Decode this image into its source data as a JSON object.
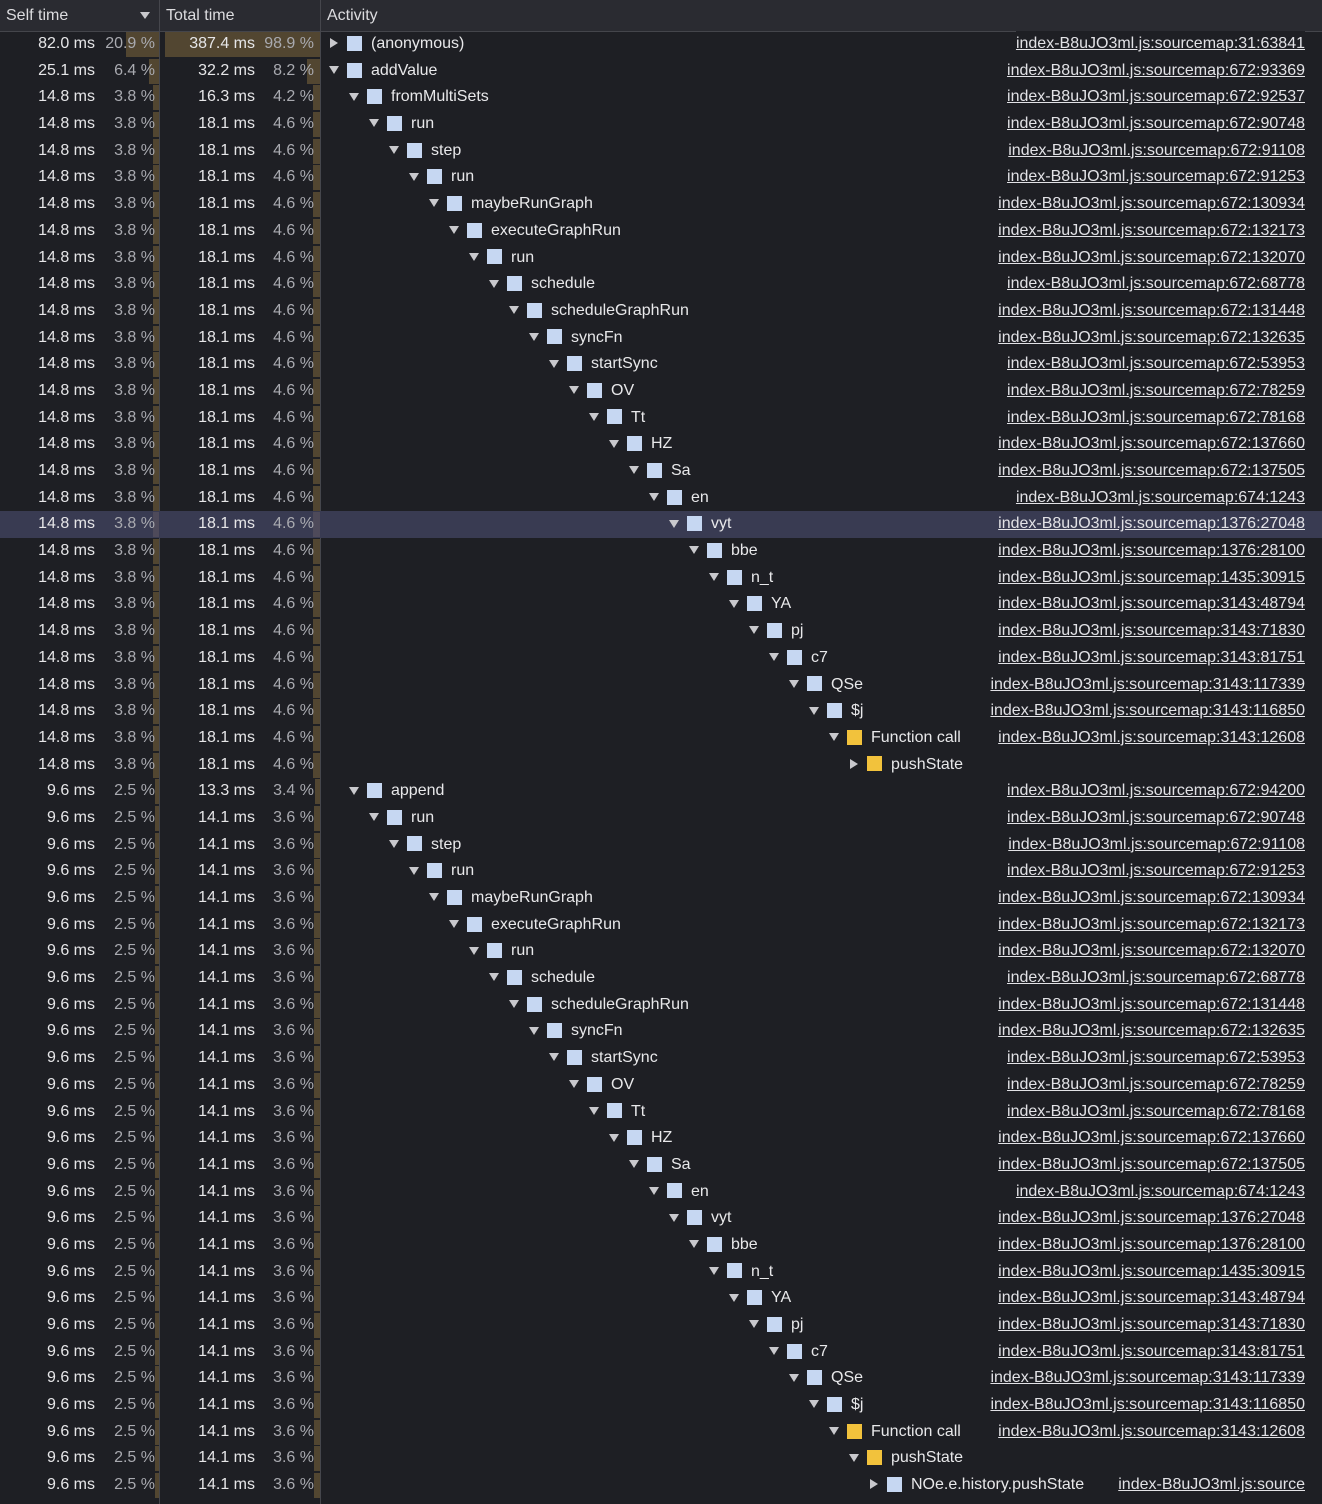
{
  "header": {
    "self_time": "Self time",
    "total_time": "Total time",
    "activity": "Activity"
  },
  "colors": {
    "background": "#1e1f24",
    "bar": "#524631",
    "selected_row": "#393b52",
    "node_icon": "#c6d7f2",
    "function_call_icon": "#f2c23c"
  },
  "rows": [
    {
      "self": "82.0 ms",
      "self_pct": "20.9 %",
      "self_frac": 0.209,
      "total": "387.4 ms",
      "total_pct": "98.9 %",
      "total_frac": 0.989,
      "depth": 0,
      "toggle": "collapsed",
      "icon": "blue",
      "name": "(anonymous)",
      "link": "index-B8uJO3ml.js:sourcemap:31:63841"
    },
    {
      "self": "25.1 ms",
      "self_pct": "6.4 %",
      "self_frac": 0.064,
      "total": "32.2 ms",
      "total_pct": "8.2 %",
      "total_frac": 0.082,
      "depth": 0,
      "toggle": "expanded",
      "icon": "blue",
      "name": "addValue",
      "link": "index-B8uJO3ml.js:sourcemap:672:93369"
    },
    {
      "self": "14.8 ms",
      "self_pct": "3.8 %",
      "self_frac": 0.038,
      "total": "16.3 ms",
      "total_pct": "4.2 %",
      "total_frac": 0.042,
      "depth": 1,
      "toggle": "expanded",
      "icon": "blue",
      "name": "fromMultiSets",
      "link": "index-B8uJO3ml.js:sourcemap:672:92537"
    },
    {
      "self": "14.8 ms",
      "self_pct": "3.8 %",
      "self_frac": 0.038,
      "total": "18.1 ms",
      "total_pct": "4.6 %",
      "total_frac": 0.046,
      "depth": 2,
      "toggle": "expanded",
      "icon": "blue",
      "name": "run",
      "link": "index-B8uJO3ml.js:sourcemap:672:90748"
    },
    {
      "self": "14.8 ms",
      "self_pct": "3.8 %",
      "self_frac": 0.038,
      "total": "18.1 ms",
      "total_pct": "4.6 %",
      "total_frac": 0.046,
      "depth": 3,
      "toggle": "expanded",
      "icon": "blue",
      "name": "step",
      "link": "index-B8uJO3ml.js:sourcemap:672:91108"
    },
    {
      "self": "14.8 ms",
      "self_pct": "3.8 %",
      "self_frac": 0.038,
      "total": "18.1 ms",
      "total_pct": "4.6 %",
      "total_frac": 0.046,
      "depth": 4,
      "toggle": "expanded",
      "icon": "blue",
      "name": "run",
      "link": "index-B8uJO3ml.js:sourcemap:672:91253"
    },
    {
      "self": "14.8 ms",
      "self_pct": "3.8 %",
      "self_frac": 0.038,
      "total": "18.1 ms",
      "total_pct": "4.6 %",
      "total_frac": 0.046,
      "depth": 5,
      "toggle": "expanded",
      "icon": "blue",
      "name": "maybeRunGraph",
      "link": "index-B8uJO3ml.js:sourcemap:672:130934"
    },
    {
      "self": "14.8 ms",
      "self_pct": "3.8 %",
      "self_frac": 0.038,
      "total": "18.1 ms",
      "total_pct": "4.6 %",
      "total_frac": 0.046,
      "depth": 6,
      "toggle": "expanded",
      "icon": "blue",
      "name": "executeGraphRun",
      "link": "index-B8uJO3ml.js:sourcemap:672:132173"
    },
    {
      "self": "14.8 ms",
      "self_pct": "3.8 %",
      "self_frac": 0.038,
      "total": "18.1 ms",
      "total_pct": "4.6 %",
      "total_frac": 0.046,
      "depth": 7,
      "toggle": "expanded",
      "icon": "blue",
      "name": "run",
      "link": "index-B8uJO3ml.js:sourcemap:672:132070"
    },
    {
      "self": "14.8 ms",
      "self_pct": "3.8 %",
      "self_frac": 0.038,
      "total": "18.1 ms",
      "total_pct": "4.6 %",
      "total_frac": 0.046,
      "depth": 8,
      "toggle": "expanded",
      "icon": "blue",
      "name": "schedule",
      "link": "index-B8uJO3ml.js:sourcemap:672:68778"
    },
    {
      "self": "14.8 ms",
      "self_pct": "3.8 %",
      "self_frac": 0.038,
      "total": "18.1 ms",
      "total_pct": "4.6 %",
      "total_frac": 0.046,
      "depth": 9,
      "toggle": "expanded",
      "icon": "blue",
      "name": "scheduleGraphRun",
      "link": "index-B8uJO3ml.js:sourcemap:672:131448"
    },
    {
      "self": "14.8 ms",
      "self_pct": "3.8 %",
      "self_frac": 0.038,
      "total": "18.1 ms",
      "total_pct": "4.6 %",
      "total_frac": 0.046,
      "depth": 10,
      "toggle": "expanded",
      "icon": "blue",
      "name": "syncFn",
      "link": "index-B8uJO3ml.js:sourcemap:672:132635"
    },
    {
      "self": "14.8 ms",
      "self_pct": "3.8 %",
      "self_frac": 0.038,
      "total": "18.1 ms",
      "total_pct": "4.6 %",
      "total_frac": 0.046,
      "depth": 11,
      "toggle": "expanded",
      "icon": "blue",
      "name": "startSync",
      "link": "index-B8uJO3ml.js:sourcemap:672:53953"
    },
    {
      "self": "14.8 ms",
      "self_pct": "3.8 %",
      "self_frac": 0.038,
      "total": "18.1 ms",
      "total_pct": "4.6 %",
      "total_frac": 0.046,
      "depth": 12,
      "toggle": "expanded",
      "icon": "blue",
      "name": "OV",
      "link": "index-B8uJO3ml.js:sourcemap:672:78259"
    },
    {
      "self": "14.8 ms",
      "self_pct": "3.8 %",
      "self_frac": 0.038,
      "total": "18.1 ms",
      "total_pct": "4.6 %",
      "total_frac": 0.046,
      "depth": 13,
      "toggle": "expanded",
      "icon": "blue",
      "name": "Tt",
      "link": "index-B8uJO3ml.js:sourcemap:672:78168"
    },
    {
      "self": "14.8 ms",
      "self_pct": "3.8 %",
      "self_frac": 0.038,
      "total": "18.1 ms",
      "total_pct": "4.6 %",
      "total_frac": 0.046,
      "depth": 14,
      "toggle": "expanded",
      "icon": "blue",
      "name": "HZ",
      "link": "index-B8uJO3ml.js:sourcemap:672:137660"
    },
    {
      "self": "14.8 ms",
      "self_pct": "3.8 %",
      "self_frac": 0.038,
      "total": "18.1 ms",
      "total_pct": "4.6 %",
      "total_frac": 0.046,
      "depth": 15,
      "toggle": "expanded",
      "icon": "blue",
      "name": "Sa",
      "link": "index-B8uJO3ml.js:sourcemap:672:137505"
    },
    {
      "self": "14.8 ms",
      "self_pct": "3.8 %",
      "self_frac": 0.038,
      "total": "18.1 ms",
      "total_pct": "4.6 %",
      "total_frac": 0.046,
      "depth": 16,
      "toggle": "expanded",
      "icon": "blue",
      "name": "en",
      "link": "index-B8uJO3ml.js:sourcemap:674:1243"
    },
    {
      "self": "14.8 ms",
      "self_pct": "3.8 %",
      "self_frac": 0.038,
      "total": "18.1 ms",
      "total_pct": "4.6 %",
      "total_frac": 0.046,
      "depth": 17,
      "toggle": "expanded",
      "icon": "blue",
      "name": "vyt",
      "link": "index-B8uJO3ml.js:sourcemap:1376:27048",
      "selected": true
    },
    {
      "self": "14.8 ms",
      "self_pct": "3.8 %",
      "self_frac": 0.038,
      "total": "18.1 ms",
      "total_pct": "4.6 %",
      "total_frac": 0.046,
      "depth": 18,
      "toggle": "expanded",
      "icon": "blue",
      "name": "bbe",
      "link": "index-B8uJO3ml.js:sourcemap:1376:28100"
    },
    {
      "self": "14.8 ms",
      "self_pct": "3.8 %",
      "self_frac": 0.038,
      "total": "18.1 ms",
      "total_pct": "4.6 %",
      "total_frac": 0.046,
      "depth": 19,
      "toggle": "expanded",
      "icon": "blue",
      "name": "n_t",
      "link": "index-B8uJO3ml.js:sourcemap:1435:30915"
    },
    {
      "self": "14.8 ms",
      "self_pct": "3.8 %",
      "self_frac": 0.038,
      "total": "18.1 ms",
      "total_pct": "4.6 %",
      "total_frac": 0.046,
      "depth": 20,
      "toggle": "expanded",
      "icon": "blue",
      "name": "YA",
      "link": "index-B8uJO3ml.js:sourcemap:3143:48794"
    },
    {
      "self": "14.8 ms",
      "self_pct": "3.8 %",
      "self_frac": 0.038,
      "total": "18.1 ms",
      "total_pct": "4.6 %",
      "total_frac": 0.046,
      "depth": 21,
      "toggle": "expanded",
      "icon": "blue",
      "name": "pj",
      "link": "index-B8uJO3ml.js:sourcemap:3143:71830"
    },
    {
      "self": "14.8 ms",
      "self_pct": "3.8 %",
      "self_frac": 0.038,
      "total": "18.1 ms",
      "total_pct": "4.6 %",
      "total_frac": 0.046,
      "depth": 22,
      "toggle": "expanded",
      "icon": "blue",
      "name": "c7",
      "link": "index-B8uJO3ml.js:sourcemap:3143:81751"
    },
    {
      "self": "14.8 ms",
      "self_pct": "3.8 %",
      "self_frac": 0.038,
      "total": "18.1 ms",
      "total_pct": "4.6 %",
      "total_frac": 0.046,
      "depth": 23,
      "toggle": "expanded",
      "icon": "blue",
      "name": "QSe",
      "link": "index-B8uJO3ml.js:sourcemap:3143:117339"
    },
    {
      "self": "14.8 ms",
      "self_pct": "3.8 %",
      "self_frac": 0.038,
      "total": "18.1 ms",
      "total_pct": "4.6 %",
      "total_frac": 0.046,
      "depth": 24,
      "toggle": "expanded",
      "icon": "blue",
      "name": "$j",
      "link": "index-B8uJO3ml.js:sourcemap:3143:116850"
    },
    {
      "self": "14.8 ms",
      "self_pct": "3.8 %",
      "self_frac": 0.038,
      "total": "18.1 ms",
      "total_pct": "4.6 %",
      "total_frac": 0.046,
      "depth": 25,
      "toggle": "expanded",
      "icon": "yellow",
      "name": "Function call",
      "link": "index-B8uJO3ml.js:sourcemap:3143:12608",
      "clip": true
    },
    {
      "self": "14.8 ms",
      "self_pct": "3.8 %",
      "self_frac": 0.038,
      "total": "18.1 ms",
      "total_pct": "4.6 %",
      "total_frac": 0.046,
      "depth": 26,
      "toggle": "collapsed",
      "icon": "yellow",
      "name": "pushState",
      "link": ""
    },
    {
      "self": "9.6 ms",
      "self_pct": "2.5 %",
      "self_frac": 0.025,
      "total": "13.3 ms",
      "total_pct": "3.4 %",
      "total_frac": 0.034,
      "depth": 1,
      "toggle": "expanded",
      "icon": "blue",
      "name": "append",
      "link": "index-B8uJO3ml.js:sourcemap:672:94200"
    },
    {
      "self": "9.6 ms",
      "self_pct": "2.5 %",
      "self_frac": 0.025,
      "total": "14.1 ms",
      "total_pct": "3.6 %",
      "total_frac": 0.036,
      "depth": 2,
      "toggle": "expanded",
      "icon": "blue",
      "name": "run",
      "link": "index-B8uJO3ml.js:sourcemap:672:90748"
    },
    {
      "self": "9.6 ms",
      "self_pct": "2.5 %",
      "self_frac": 0.025,
      "total": "14.1 ms",
      "total_pct": "3.6 %",
      "total_frac": 0.036,
      "depth": 3,
      "toggle": "expanded",
      "icon": "blue",
      "name": "step",
      "link": "index-B8uJO3ml.js:sourcemap:672:91108"
    },
    {
      "self": "9.6 ms",
      "self_pct": "2.5 %",
      "self_frac": 0.025,
      "total": "14.1 ms",
      "total_pct": "3.6 %",
      "total_frac": 0.036,
      "depth": 4,
      "toggle": "expanded",
      "icon": "blue",
      "name": "run",
      "link": "index-B8uJO3ml.js:sourcemap:672:91253"
    },
    {
      "self": "9.6 ms",
      "self_pct": "2.5 %",
      "self_frac": 0.025,
      "total": "14.1 ms",
      "total_pct": "3.6 %",
      "total_frac": 0.036,
      "depth": 5,
      "toggle": "expanded",
      "icon": "blue",
      "name": "maybeRunGraph",
      "link": "index-B8uJO3ml.js:sourcemap:672:130934"
    },
    {
      "self": "9.6 ms",
      "self_pct": "2.5 %",
      "self_frac": 0.025,
      "total": "14.1 ms",
      "total_pct": "3.6 %",
      "total_frac": 0.036,
      "depth": 6,
      "toggle": "expanded",
      "icon": "blue",
      "name": "executeGraphRun",
      "link": "index-B8uJO3ml.js:sourcemap:672:132173"
    },
    {
      "self": "9.6 ms",
      "self_pct": "2.5 %",
      "self_frac": 0.025,
      "total": "14.1 ms",
      "total_pct": "3.6 %",
      "total_frac": 0.036,
      "depth": 7,
      "toggle": "expanded",
      "icon": "blue",
      "name": "run",
      "link": "index-B8uJO3ml.js:sourcemap:672:132070"
    },
    {
      "self": "9.6 ms",
      "self_pct": "2.5 %",
      "self_frac": 0.025,
      "total": "14.1 ms",
      "total_pct": "3.6 %",
      "total_frac": 0.036,
      "depth": 8,
      "toggle": "expanded",
      "icon": "blue",
      "name": "schedule",
      "link": "index-B8uJO3ml.js:sourcemap:672:68778"
    },
    {
      "self": "9.6 ms",
      "self_pct": "2.5 %",
      "self_frac": 0.025,
      "total": "14.1 ms",
      "total_pct": "3.6 %",
      "total_frac": 0.036,
      "depth": 9,
      "toggle": "expanded",
      "icon": "blue",
      "name": "scheduleGraphRun",
      "link": "index-B8uJO3ml.js:sourcemap:672:131448"
    },
    {
      "self": "9.6 ms",
      "self_pct": "2.5 %",
      "self_frac": 0.025,
      "total": "14.1 ms",
      "total_pct": "3.6 %",
      "total_frac": 0.036,
      "depth": 10,
      "toggle": "expanded",
      "icon": "blue",
      "name": "syncFn",
      "link": "index-B8uJO3ml.js:sourcemap:672:132635"
    },
    {
      "self": "9.6 ms",
      "self_pct": "2.5 %",
      "self_frac": 0.025,
      "total": "14.1 ms",
      "total_pct": "3.6 %",
      "total_frac": 0.036,
      "depth": 11,
      "toggle": "expanded",
      "icon": "blue",
      "name": "startSync",
      "link": "index-B8uJO3ml.js:sourcemap:672:53953"
    },
    {
      "self": "9.6 ms",
      "self_pct": "2.5 %",
      "self_frac": 0.025,
      "total": "14.1 ms",
      "total_pct": "3.6 %",
      "total_frac": 0.036,
      "depth": 12,
      "toggle": "expanded",
      "icon": "blue",
      "name": "OV",
      "link": "index-B8uJO3ml.js:sourcemap:672:78259"
    },
    {
      "self": "9.6 ms",
      "self_pct": "2.5 %",
      "self_frac": 0.025,
      "total": "14.1 ms",
      "total_pct": "3.6 %",
      "total_frac": 0.036,
      "depth": 13,
      "toggle": "expanded",
      "icon": "blue",
      "name": "Tt",
      "link": "index-B8uJO3ml.js:sourcemap:672:78168"
    },
    {
      "self": "9.6 ms",
      "self_pct": "2.5 %",
      "self_frac": 0.025,
      "total": "14.1 ms",
      "total_pct": "3.6 %",
      "total_frac": 0.036,
      "depth": 14,
      "toggle": "expanded",
      "icon": "blue",
      "name": "HZ",
      "link": "index-B8uJO3ml.js:sourcemap:672:137660"
    },
    {
      "self": "9.6 ms",
      "self_pct": "2.5 %",
      "self_frac": 0.025,
      "total": "14.1 ms",
      "total_pct": "3.6 %",
      "total_frac": 0.036,
      "depth": 15,
      "toggle": "expanded",
      "icon": "blue",
      "name": "Sa",
      "link": "index-B8uJO3ml.js:sourcemap:672:137505"
    },
    {
      "self": "9.6 ms",
      "self_pct": "2.5 %",
      "self_frac": 0.025,
      "total": "14.1 ms",
      "total_pct": "3.6 %",
      "total_frac": 0.036,
      "depth": 16,
      "toggle": "expanded",
      "icon": "blue",
      "name": "en",
      "link": "index-B8uJO3ml.js:sourcemap:674:1243"
    },
    {
      "self": "9.6 ms",
      "self_pct": "2.5 %",
      "self_frac": 0.025,
      "total": "14.1 ms",
      "total_pct": "3.6 %",
      "total_frac": 0.036,
      "depth": 17,
      "toggle": "expanded",
      "icon": "blue",
      "name": "vyt",
      "link": "index-B8uJO3ml.js:sourcemap:1376:27048"
    },
    {
      "self": "9.6 ms",
      "self_pct": "2.5 %",
      "self_frac": 0.025,
      "total": "14.1 ms",
      "total_pct": "3.6 %",
      "total_frac": 0.036,
      "depth": 18,
      "toggle": "expanded",
      "icon": "blue",
      "name": "bbe",
      "link": "index-B8uJO3ml.js:sourcemap:1376:28100"
    },
    {
      "self": "9.6 ms",
      "self_pct": "2.5 %",
      "self_frac": 0.025,
      "total": "14.1 ms",
      "total_pct": "3.6 %",
      "total_frac": 0.036,
      "depth": 19,
      "toggle": "expanded",
      "icon": "blue",
      "name": "n_t",
      "link": "index-B8uJO3ml.js:sourcemap:1435:30915"
    },
    {
      "self": "9.6 ms",
      "self_pct": "2.5 %",
      "self_frac": 0.025,
      "total": "14.1 ms",
      "total_pct": "3.6 %",
      "total_frac": 0.036,
      "depth": 20,
      "toggle": "expanded",
      "icon": "blue",
      "name": "YA",
      "link": "index-B8uJO3ml.js:sourcemap:3143:48794"
    },
    {
      "self": "9.6 ms",
      "self_pct": "2.5 %",
      "self_frac": 0.025,
      "total": "14.1 ms",
      "total_pct": "3.6 %",
      "total_frac": 0.036,
      "depth": 21,
      "toggle": "expanded",
      "icon": "blue",
      "name": "pj",
      "link": "index-B8uJO3ml.js:sourcemap:3143:71830"
    },
    {
      "self": "9.6 ms",
      "self_pct": "2.5 %",
      "self_frac": 0.025,
      "total": "14.1 ms",
      "total_pct": "3.6 %",
      "total_frac": 0.036,
      "depth": 22,
      "toggle": "expanded",
      "icon": "blue",
      "name": "c7",
      "link": "index-B8uJO3ml.js:sourcemap:3143:81751"
    },
    {
      "self": "9.6 ms",
      "self_pct": "2.5 %",
      "self_frac": 0.025,
      "total": "14.1 ms",
      "total_pct": "3.6 %",
      "total_frac": 0.036,
      "depth": 23,
      "toggle": "expanded",
      "icon": "blue",
      "name": "QSe",
      "link": "index-B8uJO3ml.js:sourcemap:3143:117339"
    },
    {
      "self": "9.6 ms",
      "self_pct": "2.5 %",
      "self_frac": 0.025,
      "total": "14.1 ms",
      "total_pct": "3.6 %",
      "total_frac": 0.036,
      "depth": 24,
      "toggle": "expanded",
      "icon": "blue",
      "name": "$j",
      "link": "index-B8uJO3ml.js:sourcemap:3143:116850"
    },
    {
      "self": "9.6 ms",
      "self_pct": "2.5 %",
      "self_frac": 0.025,
      "total": "14.1 ms",
      "total_pct": "3.6 %",
      "total_frac": 0.036,
      "depth": 25,
      "toggle": "expanded",
      "icon": "yellow",
      "name": "Function call",
      "link": "index-B8uJO3ml.js:sourcemap:3143:12608",
      "clip": true
    },
    {
      "self": "9.6 ms",
      "self_pct": "2.5 %",
      "self_frac": 0.025,
      "total": "14.1 ms",
      "total_pct": "3.6 %",
      "total_frac": 0.036,
      "depth": 26,
      "toggle": "expanded",
      "icon": "yellow",
      "name": "pushState",
      "link": ""
    },
    {
      "self": "9.6 ms",
      "self_pct": "2.5 %",
      "self_frac": 0.025,
      "total": "14.1 ms",
      "total_pct": "3.6 %",
      "total_frac": 0.036,
      "depth": 27,
      "toggle": "collapsed",
      "icon": "blue",
      "name": "NOe.e.history.pushState",
      "link": "index-B8uJO3ml.js:source",
      "clip": true
    }
  ]
}
